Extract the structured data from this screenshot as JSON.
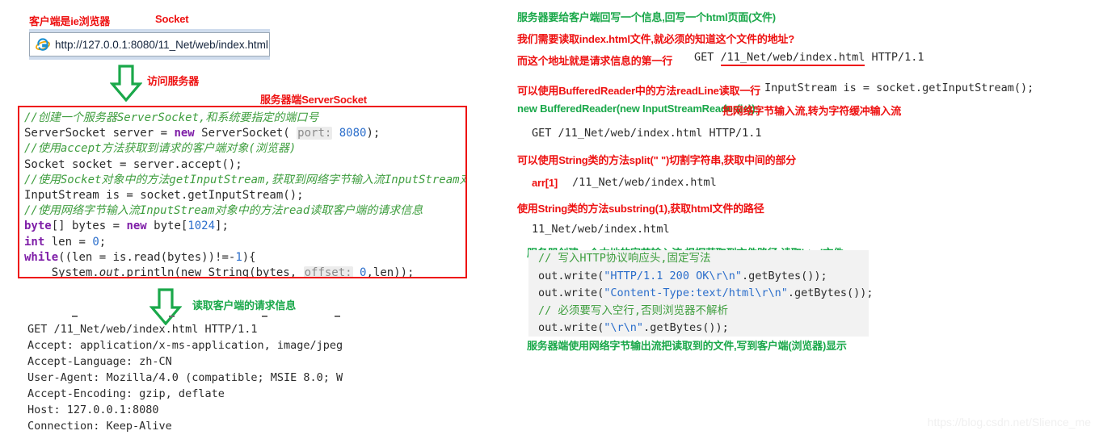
{
  "left": {
    "label_client": "客户端是ie浏览器",
    "label_socket": "Socket",
    "browser": {
      "url": "http://127.0.0.1:8080/11_Net/web/index.html",
      "icon": "ie-browser-icon"
    },
    "arrow1_label": "访问服务器",
    "label_serversocket": "服务器端ServerSocket",
    "code": {
      "l1_comment": "//创建一个服务器ServerSocket,和系统要指定的端口号",
      "l2_a": "ServerSocket server = ",
      "l2_kw": "new",
      "l2_b": " ServerSocket( ",
      "l2_hint": "port:",
      "l2_num": " 8080",
      "l2_c": ");",
      "l3_comment": "//使用accept方法获取到请求的客户端对象(浏览器)",
      "l4": "Socket socket = server.accept();",
      "l5_comment": "//使用Socket对象中的方法getInputStream,获取到网络字节输入流InputStream对象",
      "l6": "InputStream is = socket.getInputStream();",
      "l7_comment": "//使用网络字节输入流InputStream对象中的方法read读取客户端的请求信息",
      "l8_a": "byte",
      "l8_b": "[] bytes = ",
      "l8_kw": "new",
      "l8_c": " byte[",
      "l8_num": "1024",
      "l8_d": "];",
      "l9_a": "int",
      "l9_b": " len = ",
      "l9_num": "0",
      "l9_c": ";",
      "l10_a": "while",
      "l10_b": "((len = is.read(bytes))!=-",
      "l10_num": "1",
      "l10_c": "){",
      "l11_a": "    System.",
      "l11_out": "out",
      "l11_b": ".println(new String(bytes, ",
      "l11_hint": "offset:",
      "l11_num": " 0",
      "l11_c": ",len));",
      "l12": "}"
    },
    "arrow2_label": "读取客户端的请求信息",
    "request": [
      "GET /11_Net/web/index.html HTTP/1.1",
      "Accept: application/x-ms-application, image/jpeg",
      "Accept-Language: zh-CN",
      "User-Agent: Mozilla/4.0 (compatible; MSIE 8.0; W",
      "Accept-Encoding: gzip, deflate",
      "Host: 127.0.0.1:8080",
      "Connection: Keep-Alive"
    ]
  },
  "right": {
    "line1_green": "服务器要给客户端回写一个信息,回写一个html页面(文件)",
    "line2_red": "我们需要读取index.html文件,就必须的知道这个文件的地址?",
    "line3_red": "而这个地址就是请求信息的第一行",
    "line3_code_pre": "GET ",
    "line3_code_underlined": "/11_Net/web/index.html",
    "line3_code_post": " HTTP/1.1",
    "line4_red": "可以使用BufferedReader中的方法readLine读取一行",
    "line4_code": "InputStream is = socket.getInputStream();",
    "line5_green": "new BufferedReader(new InputStreamReader(is));",
    "line5_red": "把网络字节输入流,转为字符缓冲输入流",
    "line6_code": "GET /11_Net/web/index.html HTTP/1.1",
    "line7_red": "可以使用String类的方法split(\" \")切割字符串,获取中间的部分",
    "line8_red": "arr[1]",
    "line8_code": "/11_Net/web/index.html",
    "line9_red": "使用String类的方法substring(1),获取html文件的路径",
    "line10_code": "11_Net/web/index.html",
    "line11_green": "服务器创建一个本地的字节输入流,根据获取到文件路径,读取html文件",
    "code_box": {
      "c1": "// 写入HTTP协议响应头,固定写法",
      "c2_a": "out.write(",
      "c2_str": "\"HTTP/1.1 200 OK\\r\\n\"",
      "c2_b": ".getBytes());",
      "c3_a": "out.write(",
      "c3_str": "\"Content-Type:text/html\\r\\n\"",
      "c3_b": ".getBytes());",
      "c4": "// 必须要写入空行,否则浏览器不解析",
      "c5_a": "out.write(",
      "c5_str": "\"\\r\\n\"",
      "c5_b": ".getBytes());"
    },
    "line12_green": "服务器端使用网络字节输出流把读取到的文件,写到客户端(浏览器)显示"
  },
  "watermark": "https://blog.csdn.net/Slience_me",
  "colors": {
    "red": "#ee1111",
    "green": "#1aa84a",
    "comment_green": "#3f9e3f",
    "keyword_purple": "#7f1fa8",
    "number_blue": "#2b6ecb",
    "gray_box": "#f2f2f2"
  }
}
